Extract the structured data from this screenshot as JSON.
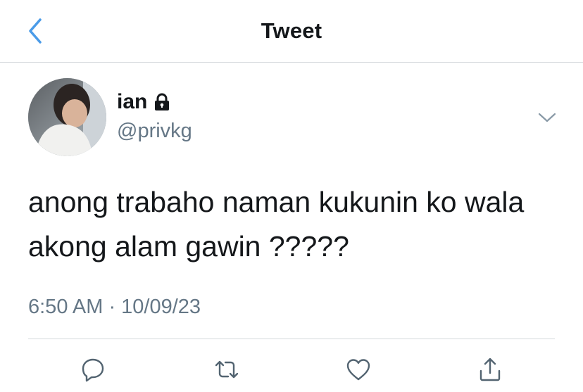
{
  "header": {
    "title": "Tweet",
    "back_icon": "chevron-left-icon"
  },
  "author": {
    "name": "ian",
    "handle": "@privkg",
    "locked_icon": "lock-icon",
    "avatar_icon": "avatar-photo"
  },
  "tweet": {
    "text": "anong trabaho naman kukunin ko wala\nakong alam gawin ?????",
    "timestamp": "6:50 AM · 10/09/23",
    "menu_icon": "chevron-down-icon"
  },
  "actions": [
    {
      "icon": "reply-icon"
    },
    {
      "icon": "retweet-icon"
    },
    {
      "icon": "like-icon"
    },
    {
      "icon": "share-icon"
    }
  ],
  "colors": {
    "accent": "#4a9be8",
    "secondary_text": "#657786",
    "divider": "#d5d9dc",
    "icon": "#536471"
  }
}
